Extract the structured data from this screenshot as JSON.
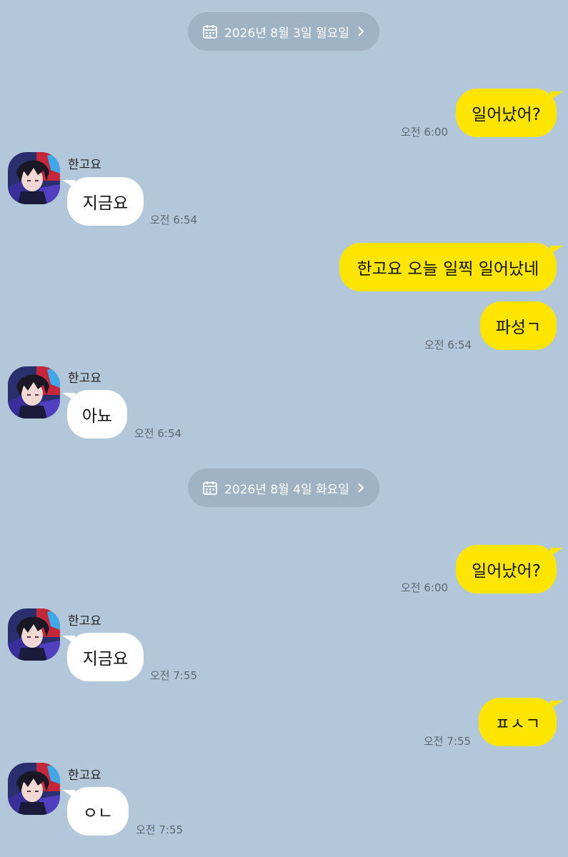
{
  "contact": {
    "name": "한고요"
  },
  "colors": {
    "background": "#b2c7d9",
    "my_bubble": "#fee500",
    "their_bubble": "#ffffff",
    "date_pill": "#9fb3c5"
  },
  "dates": [
    {
      "label": "2026년 8월 3일 월요일",
      "icon": "calendar-icon"
    },
    {
      "label": "2026년 8월 4일 화요일",
      "icon": "calendar-icon"
    }
  ],
  "messages": [
    {
      "from": "me",
      "text": "일어났어?",
      "time": "오전 6:00"
    },
    {
      "from": "them",
      "sender": "한고요",
      "text": "지금요",
      "time": "오전 6:54"
    },
    {
      "from": "me",
      "text": "한고요 오늘 일찍 일어났네"
    },
    {
      "from": "me",
      "text": "파성ㄱ",
      "time": "오전 6:54"
    },
    {
      "from": "them",
      "sender": "한고요",
      "text": "아뇨",
      "time": "오전 6:54"
    },
    {
      "from": "me",
      "text": "일어났어?",
      "time": "오전 6:00"
    },
    {
      "from": "them",
      "sender": "한고요",
      "text": "지금요",
      "time": "오전 7:55"
    },
    {
      "from": "me",
      "text": "ㅍㅅㄱ",
      "time": "오전 7:55"
    },
    {
      "from": "them",
      "sender": "한고요",
      "text": "ㅇㄴ",
      "time": "오전 7:55"
    }
  ]
}
